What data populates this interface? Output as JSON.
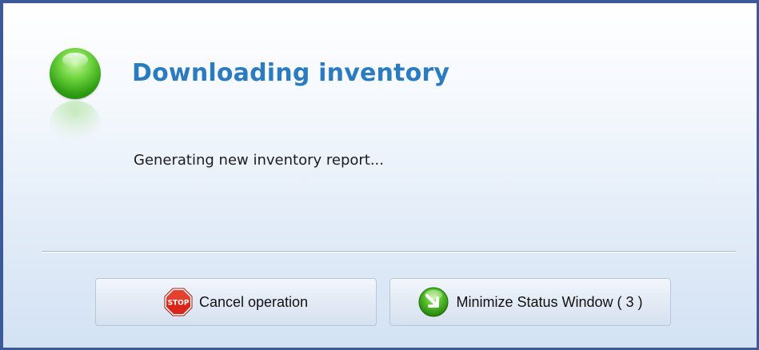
{
  "dialog": {
    "title": "Downloading inventory",
    "message": "Generating new inventory report..."
  },
  "buttons": {
    "cancel": {
      "label": "Cancel operation",
      "icon": "stop-sign-icon"
    },
    "minimize": {
      "label": "Minimize Status Window ( 3 )",
      "icon": "green-arrow-icon"
    }
  },
  "icons": {
    "stop_text": "STOP",
    "status": "green-status-orb-icon"
  },
  "colors": {
    "title": "#2a7bc0",
    "border": "#3c5a9a",
    "stop_red": "#d8261b",
    "status_green": "#4cbb25"
  }
}
